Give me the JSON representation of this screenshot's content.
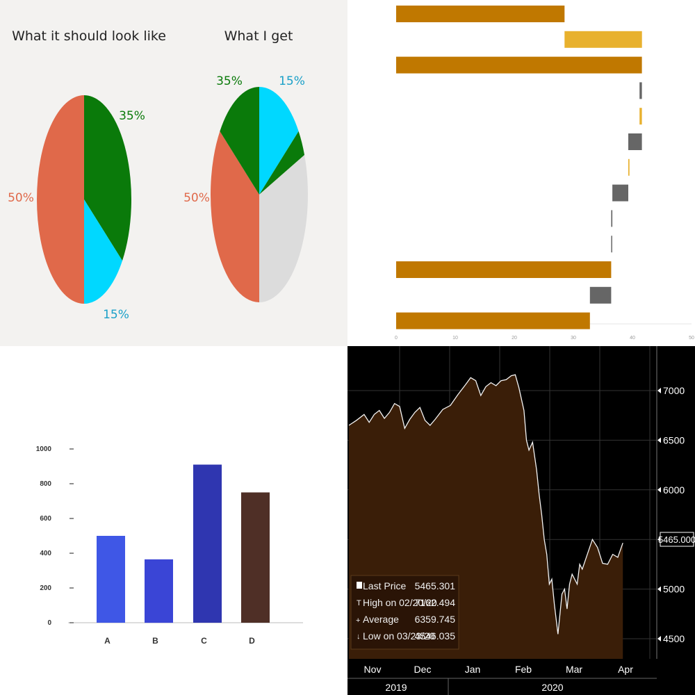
{
  "chart_data": [
    {
      "type": "pie",
      "title": "What it should look like",
      "slices": [
        {
          "label": "50%",
          "value": 50,
          "color": "#e0694a"
        },
        {
          "label": "35%",
          "value": 35,
          "color": "#0a7a0a"
        },
        {
          "label": "15%",
          "value": 15,
          "color": "#00d8ff"
        }
      ],
      "label_colors": {
        "50%": "#e0694a",
        "35%": "#0a7a0a",
        "15%": "#1aa0c8"
      }
    },
    {
      "type": "pie",
      "title": "What I get",
      "slices": [
        {
          "label": "15%",
          "value": 15,
          "color": "#00d8ff"
        },
        {
          "label": "",
          "value": 4,
          "color": "#0a7a0a"
        },
        {
          "label": "",
          "value": 31,
          "color": "#dcdcdc"
        },
        {
          "label": "50%",
          "value": 35,
          "color": "#e0694a"
        },
        {
          "label": "35%",
          "value": 15,
          "color": "#0a7a0a"
        }
      ]
    },
    {
      "type": "bar",
      "subtype": "waterfall",
      "xlim": [
        0,
        50
      ],
      "xticks": [
        "0",
        "10",
        "20",
        "30",
        "40",
        "50"
      ],
      "bars": [
        {
          "start": 0,
          "end": 28.5,
          "color": "#c07800"
        },
        {
          "start": 28.5,
          "end": 41.6,
          "color": "#e8b12e"
        },
        {
          "start": 0,
          "end": 41.6,
          "color": "#c07800"
        },
        {
          "start": 41.2,
          "end": 41.6,
          "color": "#666666"
        },
        {
          "start": 41.2,
          "end": 41.6,
          "color": "#e8b12e"
        },
        {
          "start": 39.3,
          "end": 41.6,
          "color": "#666666"
        },
        {
          "start": 39.3,
          "end": 39.5,
          "color": "#e8b12e"
        },
        {
          "start": 36.6,
          "end": 39.3,
          "color": "#666666"
        },
        {
          "start": 36.4,
          "end": 36.6,
          "color": "#666666"
        },
        {
          "start": 36.4,
          "end": 36.5,
          "color": "#666666"
        },
        {
          "start": 0,
          "end": 36.4,
          "color": "#c07800"
        },
        {
          "start": 32.8,
          "end": 36.4,
          "color": "#666666"
        },
        {
          "start": 0,
          "end": 32.8,
          "color": "#c07800"
        }
      ]
    },
    {
      "type": "bar",
      "categories": [
        "A",
        "B",
        "C",
        "D"
      ],
      "values": [
        500,
        365,
        910,
        750
      ],
      "colors": [
        "#3f57e6",
        "#3a45d6",
        "#2f36b0",
        "#4f2f26"
      ],
      "ylim": [
        0,
        1000
      ],
      "yticks": [
        0,
        200,
        400,
        600,
        800,
        1000
      ]
    },
    {
      "type": "area",
      "ylim": [
        4400,
        7400
      ],
      "yticks": [
        4500,
        5000,
        5500,
        6000,
        6500,
        7000
      ],
      "month_labels": [
        "Nov",
        "Dec",
        "Jan",
        "Feb",
        "Mar",
        "Apr"
      ],
      "year_labels": [
        "2019",
        "2020"
      ],
      "last_value_label": "5465.000",
      "legend": [
        {
          "label": "Last Price",
          "value": "5465.301"
        },
        {
          "label": "High on 02/20/20",
          "value": "7162.494"
        },
        {
          "label": "Average",
          "value": "6359.745"
        },
        {
          "label": "Low on 03/23/20",
          "value": "4546.035"
        }
      ],
      "series": [
        {
          "x": 0.0,
          "y": 6650
        },
        {
          "x": 0.15,
          "y": 6700
        },
        {
          "x": 0.3,
          "y": 6760
        },
        {
          "x": 0.4,
          "y": 6680
        },
        {
          "x": 0.5,
          "y": 6760
        },
        {
          "x": 0.6,
          "y": 6800
        },
        {
          "x": 0.7,
          "y": 6720
        },
        {
          "x": 0.8,
          "y": 6780
        },
        {
          "x": 0.9,
          "y": 6870
        },
        {
          "x": 1.0,
          "y": 6840
        },
        {
          "x": 1.1,
          "y": 6620
        },
        {
          "x": 1.2,
          "y": 6710
        },
        {
          "x": 1.3,
          "y": 6780
        },
        {
          "x": 1.4,
          "y": 6830
        },
        {
          "x": 1.5,
          "y": 6700
        },
        {
          "x": 1.6,
          "y": 6650
        },
        {
          "x": 1.7,
          "y": 6710
        },
        {
          "x": 1.85,
          "y": 6810
        },
        {
          "x": 2.0,
          "y": 6850
        },
        {
          "x": 2.15,
          "y": 6960
        },
        {
          "x": 2.3,
          "y": 7060
        },
        {
          "x": 2.4,
          "y": 7130
        },
        {
          "x": 2.5,
          "y": 7100
        },
        {
          "x": 2.6,
          "y": 6950
        },
        {
          "x": 2.7,
          "y": 7040
        },
        {
          "x": 2.8,
          "y": 7080
        },
        {
          "x": 2.9,
          "y": 7050
        },
        {
          "x": 3.0,
          "y": 7100
        },
        {
          "x": 3.1,
          "y": 7110
        },
        {
          "x": 3.2,
          "y": 7150
        },
        {
          "x": 3.28,
          "y": 7160
        },
        {
          "x": 3.35,
          "y": 7030
        },
        {
          "x": 3.45,
          "y": 6800
        },
        {
          "x": 3.5,
          "y": 6500
        },
        {
          "x": 3.55,
          "y": 6400
        },
        {
          "x": 3.62,
          "y": 6480
        },
        {
          "x": 3.7,
          "y": 6200
        },
        {
          "x": 3.75,
          "y": 5950
        },
        {
          "x": 3.8,
          "y": 5750
        },
        {
          "x": 3.85,
          "y": 5500
        },
        {
          "x": 3.9,
          "y": 5350
        },
        {
          "x": 3.95,
          "y": 5050
        },
        {
          "x": 4.0,
          "y": 5100
        },
        {
          "x": 4.05,
          "y": 4850
        },
        {
          "x": 4.12,
          "y": 4546
        },
        {
          "x": 4.2,
          "y": 4950
        },
        {
          "x": 4.25,
          "y": 5000
        },
        {
          "x": 4.3,
          "y": 4800
        },
        {
          "x": 4.35,
          "y": 5050
        },
        {
          "x": 4.4,
          "y": 5150
        },
        {
          "x": 4.5,
          "y": 5050
        },
        {
          "x": 4.55,
          "y": 5250
        },
        {
          "x": 4.6,
          "y": 5200
        },
        {
          "x": 4.7,
          "y": 5350
        },
        {
          "x": 4.8,
          "y": 5500
        },
        {
          "x": 4.9,
          "y": 5420
        },
        {
          "x": 5.0,
          "y": 5260
        },
        {
          "x": 5.1,
          "y": 5250
        },
        {
          "x": 5.2,
          "y": 5350
        },
        {
          "x": 5.3,
          "y": 5320
        },
        {
          "x": 5.4,
          "y": 5465
        }
      ]
    }
  ]
}
